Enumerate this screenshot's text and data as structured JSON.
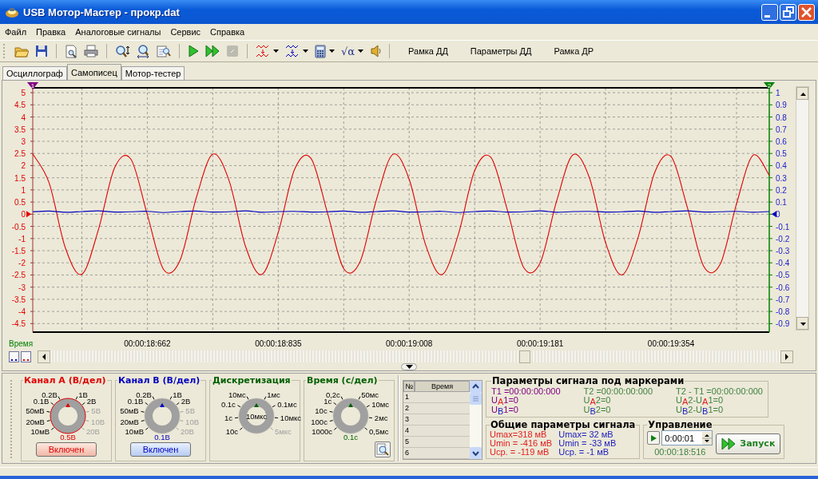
{
  "window": {
    "title": "USB Мотор-Мастер - прокр.dat"
  },
  "menu": [
    {
      "label": "Файл"
    },
    {
      "label": "Правка"
    },
    {
      "label": "Аналоговые сигналы"
    },
    {
      "label": "Сервис"
    },
    {
      "label": "Справка"
    }
  ],
  "toolbar": [
    {
      "kind": "open",
      "disabled": false,
      "dropdown": false
    },
    {
      "kind": "save",
      "disabled": false,
      "dropdown": false
    },
    {
      "kind": "sep"
    },
    {
      "kind": "preview",
      "disabled": false,
      "dropdown": false
    },
    {
      "kind": "print",
      "disabled": false,
      "dropdown": false
    },
    {
      "kind": "sep"
    },
    {
      "kind": "zoomv",
      "disabled": false,
      "dropdown": false
    },
    {
      "kind": "zoomh",
      "disabled": false,
      "dropdown": false
    },
    {
      "kind": "zoompage",
      "disabled": false,
      "dropdown": false
    },
    {
      "kind": "sep"
    },
    {
      "kind": "play",
      "disabled": false,
      "dropdown": false
    },
    {
      "kind": "ff",
      "disabled": false,
      "dropdown": false
    },
    {
      "kind": "stop",
      "disabled": true,
      "dropdown": false
    },
    {
      "kind": "sep"
    },
    {
      "kind": "wavea",
      "disabled": false,
      "dropdown": true
    },
    {
      "kind": "waveb",
      "disabled": false,
      "dropdown": true
    },
    {
      "kind": "calc",
      "disabled": false,
      "dropdown": true
    },
    {
      "kind": "text",
      "label": "√α",
      "disabled": false,
      "dropdown": true
    },
    {
      "kind": "sound",
      "disabled": false,
      "dropdown": false
    },
    {
      "kind": "sep"
    }
  ],
  "text_buttons": [
    "Рамка ДД",
    "Параметры ДД",
    "Рамка ДР"
  ],
  "tabs": [
    {
      "label": "Осциллограф",
      "selected": false
    },
    {
      "label": "Самописец",
      "selected": true
    },
    {
      "label": "Мотор-тестер",
      "selected": false
    }
  ],
  "plot": {
    "markers": [
      {
        "label": "1",
        "color": "#800080"
      },
      {
        "label": "2",
        "color": "#008000"
      }
    ],
    "right_axis_labels": [
      "1",
      "0.9",
      "0.8",
      "0.7",
      "0.6",
      "0.5",
      "0.4",
      "0.3",
      "0.2",
      "0.1",
      "0",
      "-0.1",
      "-0.2",
      "-0.3",
      "-0.4",
      "-0.5",
      "-0.6",
      "-0.7",
      "-0.8",
      "-0.9"
    ],
    "chart_data": {
      "type": "line",
      "grid": true,
      "xlabel": "Время",
      "ylim": [
        -4.85,
        5.2
      ],
      "categories": [
        null,
        null,
        null,
        null,
        null,
        null,
        null,
        "00:00:18:662",
        null,
        null,
        null,
        null,
        null,
        null,
        null,
        "00:00:18:835",
        null,
        null,
        null,
        null,
        null,
        null,
        null,
        "00:00:19:008",
        null,
        null,
        null,
        null,
        null,
        null,
        null,
        "00:00:19:181",
        null,
        null,
        null,
        null,
        null,
        null,
        null,
        "00:00:19:354",
        null,
        null,
        null,
        null,
        null,
        null
      ],
      "series": [
        {
          "color": "#e00000",
          "values": [
            2.48,
            1.29,
            -1.4,
            -2.47,
            -0.66,
            1.91,
            2.26,
            -0.02,
            -2.28,
            -1.89,
            0.7,
            2.47,
            1.37,
            -1.33,
            -2.48,
            -0.75,
            1.85,
            2.3,
            0.07,
            -2.24,
            -1.95,
            0.61,
            2.46,
            1.44,
            -1.25,
            -2.49,
            -0.84,
            1.79,
            2.33,
            0.17,
            -2.2,
            -2.0,
            0.52,
            2.44,
            1.52,
            -1.17,
            -2.5,
            -0.92,
            1.72,
            2.37,
            0.26,
            -2.15,
            -2.06,
            0.43,
            2.42,
            1.6
          ]
        },
        {
          "color": "#0000c0",
          "values": [
            0.1,
            0.13,
            0.08,
            0.11,
            0.14,
            0.09,
            0.1,
            0.12,
            0.07,
            0.11,
            0.13,
            0.09,
            0.1,
            0.14,
            0.08,
            0.11,
            0.12,
            0.09,
            0.1,
            0.13,
            0.08,
            0.11,
            0.14,
            0.09,
            0.1,
            0.12,
            0.07,
            0.11,
            0.13,
            0.09,
            0.1,
            0.14,
            0.08,
            0.11,
            0.12,
            0.09,
            0.1,
            0.13,
            0.08,
            0.11,
            0.14,
            0.09,
            0.1,
            0.12,
            0.08,
            0.11
          ]
        }
      ],
      "yticks": [
        {
          "value": 5,
          "label": "5"
        },
        {
          "value": 4.5,
          "label": "4.5"
        },
        {
          "value": 4,
          "label": "4"
        },
        {
          "value": 3.5,
          "label": "3.5"
        },
        {
          "value": 3,
          "label": "3"
        },
        {
          "value": 2.5,
          "label": "2.5"
        },
        {
          "value": 2,
          "label": "2"
        },
        {
          "value": 1.5,
          "label": "1.5"
        },
        {
          "value": 1,
          "label": "1"
        },
        {
          "value": 0.5,
          "label": "0.5"
        },
        {
          "value": 0,
          "label": "0"
        },
        {
          "value": -0.5,
          "label": "-0.5"
        },
        {
          "value": -1,
          "label": "-1"
        },
        {
          "value": -1.5,
          "label": "-1.5"
        },
        {
          "value": -2,
          "label": "-2"
        },
        {
          "value": -2.5,
          "label": "-2.5"
        },
        {
          "value": -3,
          "label": "-3"
        },
        {
          "value": -3.5,
          "label": "-3.5"
        },
        {
          "value": -4,
          "label": "-4"
        },
        {
          "value": -4.5,
          "label": "-4.5"
        }
      ]
    }
  },
  "knobs": [
    {
      "title": "Канал А (В/дел)",
      "color": "#e00000",
      "value": "0.5В",
      "kind": "bottom",
      "left_labels": [
        {
          "text": "0.2В",
          "disabled": false
        },
        {
          "text": "0.1В",
          "disabled": false
        },
        {
          "text": "50мВ",
          "disabled": false
        },
        {
          "text": "20мВ",
          "disabled": false
        },
        {
          "text": "10мВ",
          "disabled": false
        }
      ],
      "right_labels": [
        {
          "text": "1В",
          "disabled": false
        },
        {
          "text": "2В",
          "disabled": false
        },
        {
          "text": "5В",
          "disabled": true
        },
        {
          "text": "10В",
          "disabled": true
        },
        {
          "text": "20В",
          "disabled": true
        }
      ],
      "button": {
        "label": "Включен",
        "on": true
      }
    },
    {
      "title": "Канал В (В/дел)",
      "color": "#0000c0",
      "value": "0.1В",
      "kind": "bottom",
      "left_labels": [
        {
          "text": "0.2В",
          "disabled": false
        },
        {
          "text": "0.1В",
          "disabled": false
        },
        {
          "text": "50мВ",
          "disabled": false
        },
        {
          "text": "20мВ",
          "disabled": false
        },
        {
          "text": "10мВ",
          "disabled": false
        }
      ],
      "right_labels": [
        {
          "text": "1В",
          "disabled": false
        },
        {
          "text": "2В",
          "disabled": false
        },
        {
          "text": "5В",
          "disabled": true
        },
        {
          "text": "10В",
          "disabled": true
        },
        {
          "text": "20В",
          "disabled": true
        }
      ],
      "button": {
        "label": "Включен",
        "on": true
      }
    },
    {
      "title": "Дискретизация",
      "color": "#006000",
      "value": "10мкс",
      "kind": "center",
      "left_labels": [
        {
          "text": "10мс",
          "disabled": false
        },
        {
          "text": "0.1с",
          "disabled": false
        },
        {
          "text": "1с",
          "disabled": false
        },
        {
          "text": "10с",
          "disabled": false
        }
      ],
      "right_labels": [
        {
          "text": "1мс",
          "disabled": false
        },
        {
          "text": "0.1мс",
          "disabled": false
        },
        {
          "text": "10мкс",
          "disabled": false
        },
        {
          "text": "5мкс",
          "disabled": true
        }
      ]
    },
    {
      "title": "Время (с/дел)",
      "color": "#006000",
      "value": "0.1с",
      "kind": "bottom",
      "left_labels": [
        {
          "text": "0,2с",
          "disabled": false
        },
        {
          "text": "1с",
          "disabled": false
        },
        {
          "text": "10с",
          "disabled": false
        },
        {
          "text": "100с",
          "disabled": false
        },
        {
          "text": "1000с",
          "disabled": false
        }
      ],
      "right_labels": [
        {
          "text": "50мс",
          "disabled": false
        },
        {
          "text": "10мс",
          "disabled": false
        },
        {
          "text": "2мс",
          "disabled": false
        },
        {
          "text": "0,5мс",
          "disabled": false
        }
      ]
    }
  ],
  "markers_table": {
    "columns": [
      "№",
      "Время"
    ],
    "rows": [
      "1",
      "2",
      "3",
      "4",
      "5",
      "6"
    ]
  },
  "marker_params": {
    "title": "Параметры сигнала под маркерами",
    "columns": [
      {
        "color": "#800080",
        "lines": [
          "T1 =00:00:00:000",
          "U$_{A}$1=0",
          "U$_{B}$1=0"
        ]
      },
      {
        "color": "#408040",
        "lines": [
          "T2 =00:00:00:000",
          "U$_{A}$2=0",
          "U$_{B}$2=0"
        ]
      },
      {
        "color": "#408040",
        "lines": [
          "T2 - T1 =00:00:00:000",
          "U$_{A}$2-U$_{A}$1=0",
          "U$_{B}$2-U$_{B}$1=0"
        ]
      }
    ]
  },
  "signal_params": {
    "title": "Общие параметры сигнала",
    "columns": [
      {
        "color": "#e02020",
        "lines": [
          "Umax=318 мВ",
          "Umin = -416 мВ",
          "Uср. = -119 мВ"
        ]
      },
      {
        "color": "#2020c0",
        "lines": [
          "Umax= 32 мВ",
          "Umin = -33 мВ",
          "Uср. =  -1 мВ"
        ]
      }
    ]
  },
  "control": {
    "title": "Управление",
    "interval": "0:00:01",
    "elapsed": "00:00:18:516",
    "start_button": "Запуск"
  }
}
